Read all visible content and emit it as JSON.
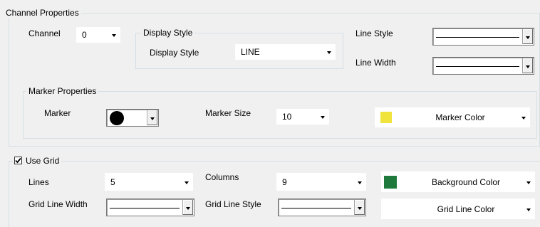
{
  "channel_properties": {
    "title": "Channel Properties",
    "channel_label": "Channel",
    "channel_value": "0",
    "display_style": {
      "group_title": "Display Style",
      "label": "Display Style",
      "value": "LINE"
    },
    "line_style_label": "Line Style",
    "line_width_label": "Line Width",
    "marker_properties": {
      "group_title": "Marker Properties",
      "marker_label": "Marker",
      "marker_icon": "filled-circle-icon",
      "marker_size_label": "Marker Size",
      "marker_size_value": "10",
      "marker_color_label": "Marker Color",
      "marker_color": "#f0e33b"
    }
  },
  "grid": {
    "use_grid_label": "Use Grid",
    "use_grid_checked": true,
    "lines_label": "Lines",
    "lines_value": "5",
    "columns_label": "Columns",
    "columns_value": "9",
    "background_color_label": "Background Color",
    "background_color": "#1e7a3c",
    "grid_line_width_label": "Grid Line Width",
    "grid_line_style_label": "Grid Line Style",
    "grid_line_color_label": "Grid Line Color",
    "grid_line_color": "#ffffff"
  }
}
